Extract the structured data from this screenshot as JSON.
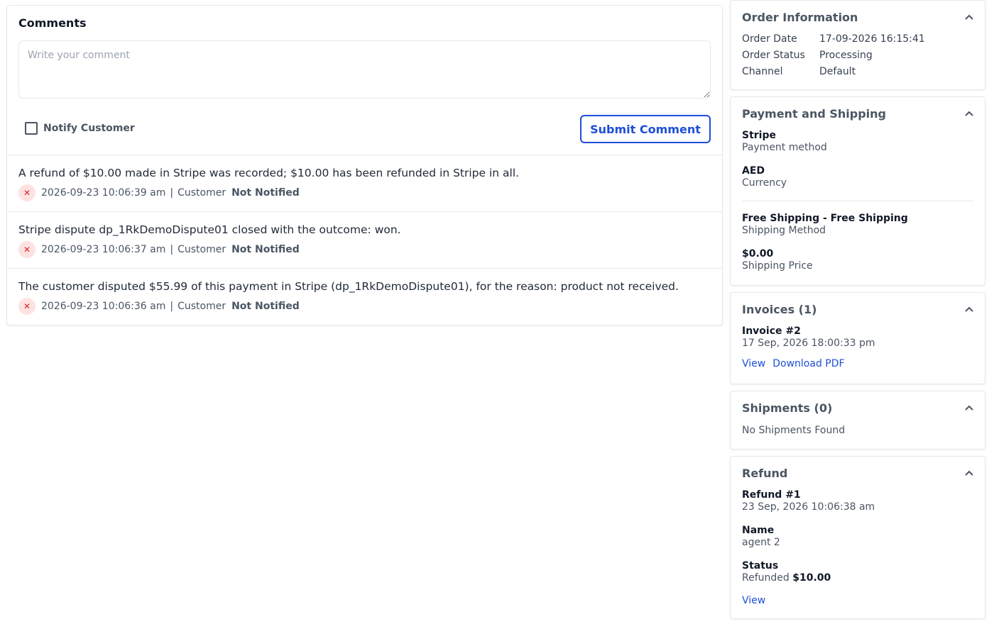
{
  "comments": {
    "title": "Comments",
    "placeholder": "Write your comment",
    "notify_label": "Notify Customer",
    "submit_label": "Submit Comment",
    "meta_separator": "|",
    "items": [
      {
        "text": "A refund of $10.00 made in Stripe was recorded; $10.00 has been refunded in Stripe in all.",
        "datetime": "2026-09-23 10:06:39 am",
        "author": "Customer",
        "status": "Not Notified"
      },
      {
        "text": "Stripe dispute dp_1RkDemoDispute01 closed with the outcome: won.",
        "datetime": "2026-09-23 10:06:37 am",
        "author": "Customer",
        "status": "Not Notified"
      },
      {
        "text": "The customer disputed $55.99 of this payment in Stripe (dp_1RkDemoDispute01), for the reason: product not received.",
        "datetime": "2026-09-23 10:06:36 am",
        "author": "Customer",
        "status": "Not Notified"
      }
    ],
    "status_icon": "close-icon",
    "status_icon_color": "#dc2626"
  },
  "order_info": {
    "title": "Order Information",
    "rows": [
      {
        "label": "Order Date",
        "value": "17-09-2026 16:15:41"
      },
      {
        "label": "Order Status",
        "value": "Processing"
      },
      {
        "label": "Channel",
        "value": "Default"
      }
    ]
  },
  "payment_shipping": {
    "title": "Payment and Shipping",
    "payment_method_value": "Stripe",
    "payment_method_label": "Payment method",
    "currency_value": "AED",
    "currency_label": "Currency",
    "shipping_method_value": "Free Shipping - Free Shipping",
    "shipping_method_label": "Shipping Method",
    "shipping_price_value": "$0.00",
    "shipping_price_label": "Shipping Price"
  },
  "invoices": {
    "title": "Invoices (1)",
    "invoice_name": "Invoice #2",
    "invoice_date": "17 Sep, 2026 18:00:33 pm",
    "view_label": "View",
    "download_label": "Download PDF"
  },
  "shipments": {
    "title": "Shipments (0)",
    "empty_text": "No Shipments Found"
  },
  "refund": {
    "title": "Refund",
    "refund_name": "Refund #1",
    "refund_date": "23 Sep, 2026 10:06:38 am",
    "name_label": "Name",
    "name_value": "agent 2",
    "status_label": "Status",
    "status_text": "Refunded",
    "status_amount": "$10.00",
    "view_label": "View"
  },
  "colors": {
    "accent": "#1d4ed8",
    "error": "#dc2626",
    "error_bg": "#fee2e2"
  }
}
